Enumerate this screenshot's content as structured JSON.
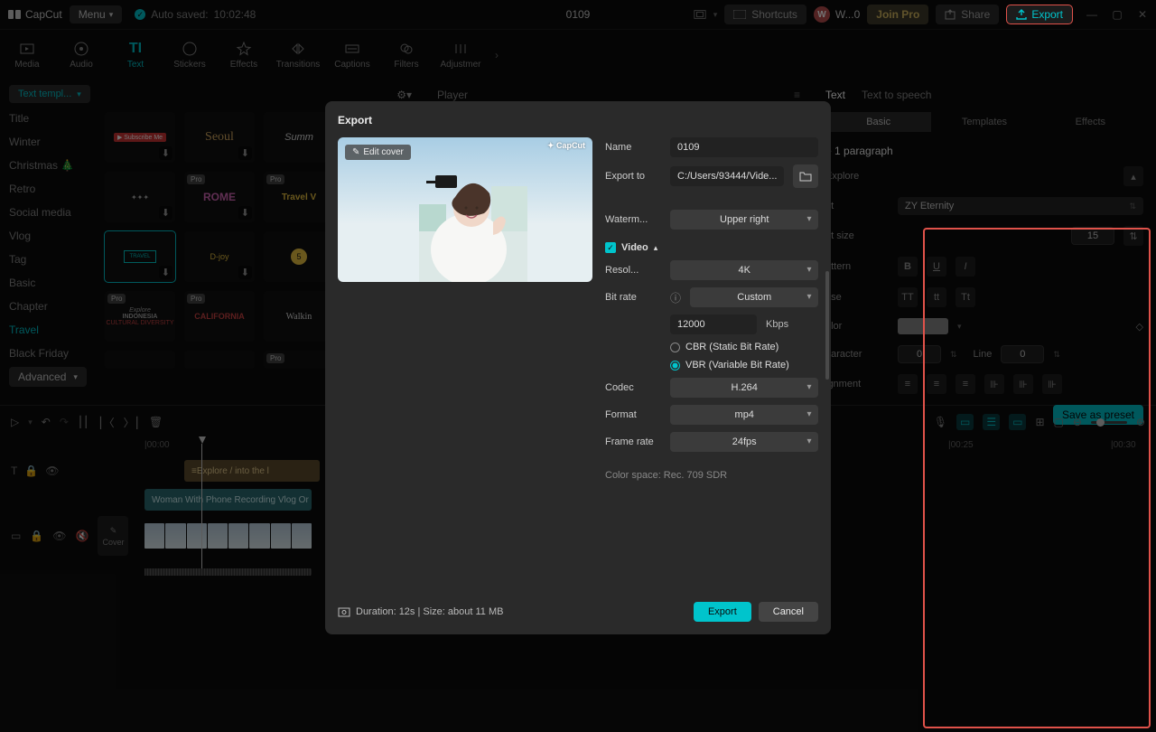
{
  "app": {
    "name": "CapCut",
    "menu": "Menu",
    "autosave_label": "Auto saved:",
    "autosave_time": "10:02:48",
    "title": "0109"
  },
  "topbar": {
    "shortcuts": "Shortcuts",
    "user": "W...0",
    "joinpro": "Join Pro",
    "share": "Share",
    "export": "Export"
  },
  "tools": [
    "Media",
    "Audio",
    "Text",
    "Stickers",
    "Effects",
    "Transitions",
    "Captions",
    "Filters",
    "Adjustmer"
  ],
  "sidebar": {
    "templ": "Text templ...",
    "cats": [
      "Title",
      "Winter",
      "Christmas 🎄",
      "Retro",
      "Social media",
      "Vlog",
      "Tag",
      "Basic",
      "Chapter",
      "Travel",
      "Black Friday"
    ],
    "advanced": "Advanced"
  },
  "player": {
    "label": "Player"
  },
  "inspector": {
    "tabs": [
      "Text",
      "Text to speech"
    ],
    "subtabs": [
      "Basic",
      "Templates",
      "Effects"
    ],
    "heading": "e 1 paragraph",
    "explore": "Explore",
    "font_lbl": "nt",
    "font": "ZY Eternity",
    "size_lbl": "nt size",
    "size": "15",
    "pattern": "attern",
    "case_lbl": "ase",
    "cases": [
      "TT",
      "tt",
      "Tt"
    ],
    "color_lbl": "olor",
    "char_lbl": "haracter",
    "char_val": "0",
    "line_lbl": "Line",
    "line_val": "0",
    "align_lbl": "ignment",
    "save_preset": "Save as preset"
  },
  "modal": {
    "title": "Export",
    "editcover": "Edit cover",
    "wm": "✦ CapCut",
    "name_lbl": "Name",
    "name_val": "0109",
    "exportto_lbl": "Export to",
    "exportto_val": "C:/Users/93444/Vide...",
    "waterm_lbl": "Waterm...",
    "waterm_val": "Upper right",
    "video_label": "Video",
    "resol_lbl": "Resol...",
    "resol_val": "4K",
    "bitrate_lbl": "Bit rate",
    "bitrate_val": "Custom",
    "bitrate_num": "12000",
    "kbps": "Kbps",
    "cbr": "CBR (Static Bit Rate)",
    "vbr": "VBR (Variable Bit Rate)",
    "codec_lbl": "Codec",
    "codec_val": "H.264",
    "format_lbl": "Format",
    "format_val": "mp4",
    "fps_lbl": "Frame rate",
    "fps_val": "24fps",
    "colorspace": "Color space: Rec. 709 SDR",
    "duration": "Duration: 12s | Size: about 11 MB",
    "export_btn": "Export",
    "cancel_btn": "Cancel"
  },
  "timeline": {
    "ticks": [
      "|00:00",
      "|00:25",
      "|00:30"
    ],
    "text_clip": "Explore / into the l",
    "video_clip": "Woman With Phone Recording Vlog Or",
    "cover": "Cover"
  }
}
